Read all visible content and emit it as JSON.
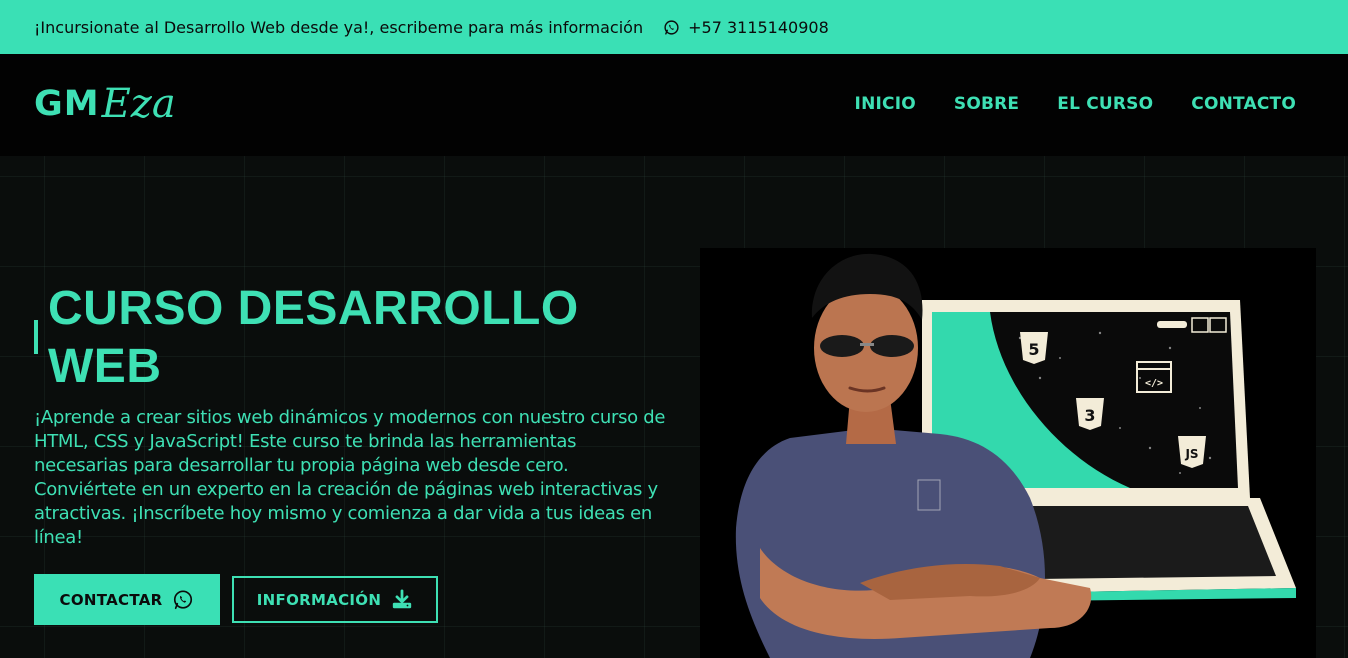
{
  "topbar": {
    "message": "¡Incursionate al Desarrollo Web desde ya!, escribeme para más información",
    "phone": "+57 3115140908",
    "icon": "whatsapp-icon"
  },
  "logo": {
    "part1": "GM",
    "part2": "Eza"
  },
  "nav": {
    "items": [
      {
        "label": "INICIO"
      },
      {
        "label": "SOBRE"
      },
      {
        "label": "EL CURSO"
      },
      {
        "label": "CONTACTO"
      }
    ]
  },
  "hero": {
    "title_line1": "CURSO DESARROLLO",
    "title_line2": "WEB",
    "description": "¡Aprende a crear sitios web dinámicos y modernos con nuestro curso de HTML, CSS y JavaScript! Este curso te brinda las herramientas necesarias para desarrollar tu propia página web desde cero. Conviértete en un experto en la creación de páginas web interactivas y atractivas. ¡Inscríbete hoy mismo y comienza a dar vida a tus ideas en línea!",
    "buttons": {
      "contact_label": "CONTACTAR",
      "contact_icon": "whatsapp-icon",
      "info_label": "INFORMACIÓN",
      "info_icon": "download-icon"
    },
    "illustration": {
      "laptop_badges": [
        "5",
        "3",
        "JS",
        "</>"
      ]
    }
  },
  "colors": {
    "accent": "#3ae0b5",
    "background": "#050505",
    "text_dark": "#0b0b0b"
  }
}
